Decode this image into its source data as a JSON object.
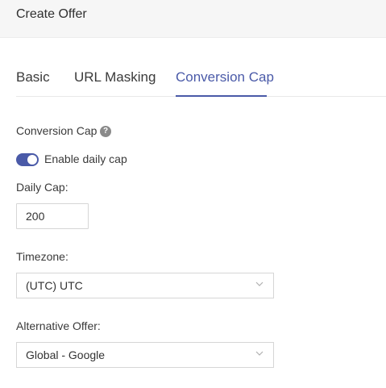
{
  "header": {
    "title": "Create Offer"
  },
  "tabs": [
    {
      "label": "Basic",
      "active": false
    },
    {
      "label": "URL Masking",
      "active": false
    },
    {
      "label": "Conversion Cap",
      "active": true
    }
  ],
  "conversion_cap": {
    "title": "Conversion Cap",
    "help_icon": "?",
    "toggle_label": "Enable daily cap",
    "toggle_enabled": true,
    "daily_cap_label": "Daily Cap:",
    "daily_cap_value": "200",
    "timezone_label": "Timezone:",
    "timezone_value": "(UTC) UTC",
    "alternative_offer_label": "Alternative Offer:",
    "alternative_offer_value": "Global - Google"
  },
  "colors": {
    "accent": "#4a5aa8",
    "header_bg": "#f6f6f6"
  }
}
